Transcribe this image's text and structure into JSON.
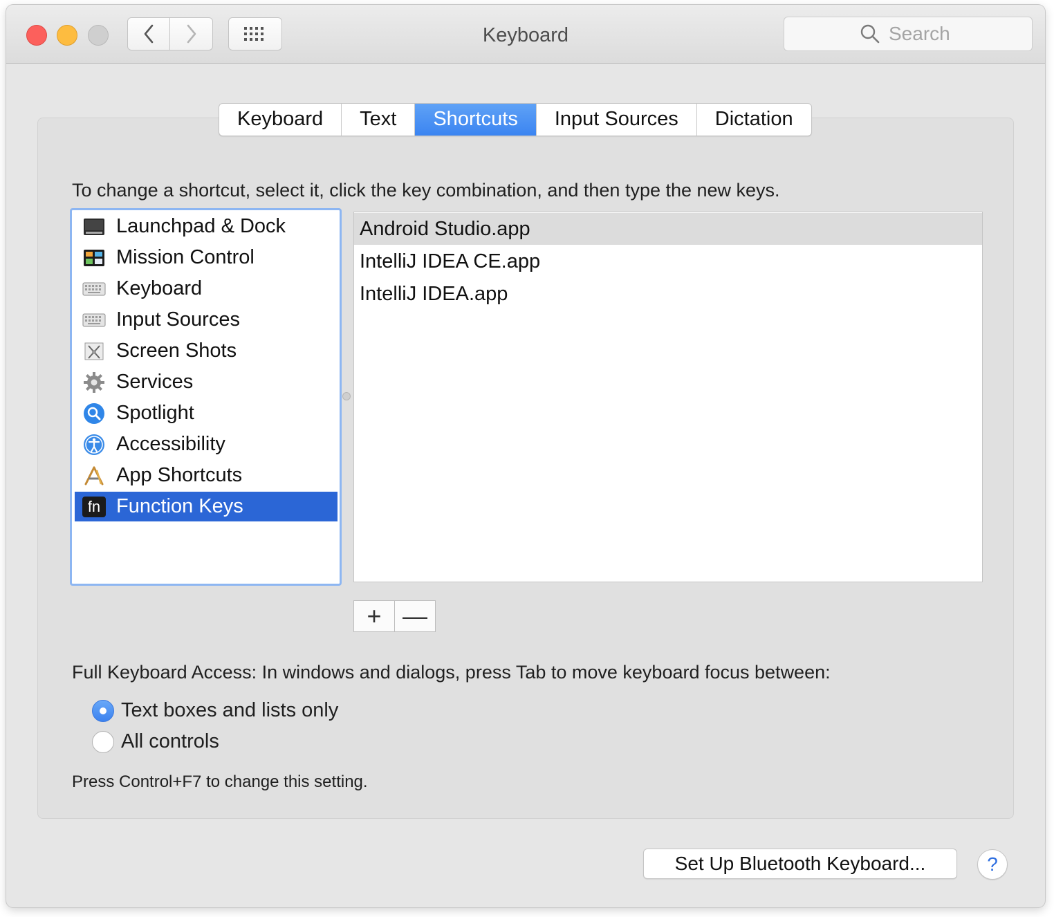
{
  "window": {
    "title": "Keyboard"
  },
  "toolbar": {
    "back_icon": "chevron-left-icon",
    "forward_icon": "chevron-right-icon",
    "show_all_icon": "grid-icon",
    "search_placeholder": "Search"
  },
  "tabs": [
    {
      "label": "Keyboard",
      "active": false
    },
    {
      "label": "Text",
      "active": false
    },
    {
      "label": "Shortcuts",
      "active": true
    },
    {
      "label": "Input Sources",
      "active": false
    },
    {
      "label": "Dictation",
      "active": false
    }
  ],
  "instruction": "To change a shortcut, select it, click the key combination, and then type the new keys.",
  "categories": [
    {
      "label": "Launchpad & Dock",
      "icon": "launchpad-dock-icon"
    },
    {
      "label": "Mission Control",
      "icon": "mission-control-icon"
    },
    {
      "label": "Keyboard",
      "icon": "keyboard-icon"
    },
    {
      "label": "Input Sources",
      "icon": "keyboard-icon"
    },
    {
      "label": "Screen Shots",
      "icon": "screenshot-icon"
    },
    {
      "label": "Services",
      "icon": "gear-icon"
    },
    {
      "label": "Spotlight",
      "icon": "spotlight-icon"
    },
    {
      "label": "Accessibility",
      "icon": "accessibility-icon"
    },
    {
      "label": "App Shortcuts",
      "icon": "app-shortcuts-icon"
    },
    {
      "label": "Function Keys",
      "icon": "fn-key-icon",
      "icon_text": "fn",
      "selected": true
    }
  ],
  "apps": [
    {
      "label": "Android Studio.app",
      "selected": true
    },
    {
      "label": "IntelliJ IDEA CE.app"
    },
    {
      "label": "IntelliJ IDEA.app"
    }
  ],
  "list_controls": {
    "add": "+",
    "remove": "—"
  },
  "full_keyboard_access": {
    "label": "Full Keyboard Access: In windows and dialogs, press Tab to move keyboard focus between:",
    "options": [
      {
        "label": "Text boxes and lists only",
        "selected": true
      },
      {
        "label": "All controls",
        "selected": false
      }
    ],
    "hint": "Press Control+F7 to change this setting."
  },
  "footer": {
    "bluetooth_button": "Set Up Bluetooth Keyboard...",
    "help": "?"
  },
  "colors": {
    "accent": "#3b84f1",
    "selection": "#2b66d6",
    "close": "#fc605c",
    "minimize": "#fdbc40"
  }
}
